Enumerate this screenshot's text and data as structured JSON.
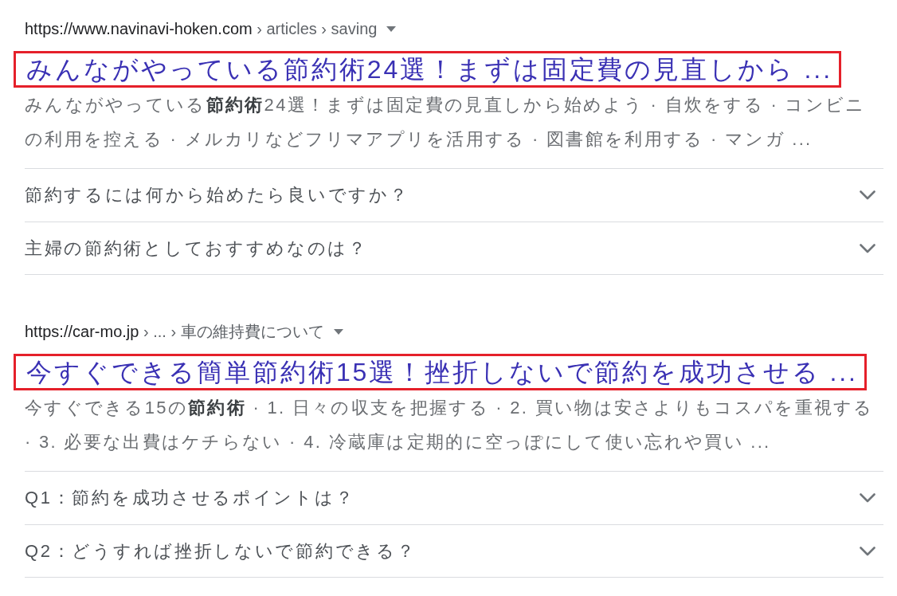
{
  "results": [
    {
      "site": "https://www.navinavi-hoken.com",
      "path": "› articles › saving",
      "title": "みんながやっている節約術24選！まずは固定費の見直しから ...",
      "highlighted": true,
      "snippet": "みんながやっている**節約術**24選！まずは固定費の見直しから始めよう · 自炊をする · コンビニの利用を控える · メルカリなどフリマアプリを活用する · 図書館を利用する · マンガ ...",
      "questions": [
        {
          "text": "節約するには何から始めたら良いですか？",
          "expanded": false
        },
        {
          "text": "主婦の節約術としておすすめなのは？",
          "expanded": false
        }
      ]
    },
    {
      "site": "https://car-mo.jp",
      "path": "› ... › 車の維持費について",
      "title": "今すぐできる簡単節約術15選！挫折しないで節約を成功させる ...",
      "highlighted": true,
      "snippet": "今すぐできる15の**節約術** · 1. 日々の収支を把握する · 2. 買い物は安さよりもコスパを重視する · 3. 必要な出費はケチらない · 4. 冷蔵庫は定期的に空っぽにして使い忘れや買い ...",
      "questions": [
        {
          "text": "Q1：節約を成功させるポイントは？",
          "expanded": false
        },
        {
          "text": "Q2：どうすれば挫折しないで節約できる？",
          "expanded": false
        }
      ]
    }
  ]
}
